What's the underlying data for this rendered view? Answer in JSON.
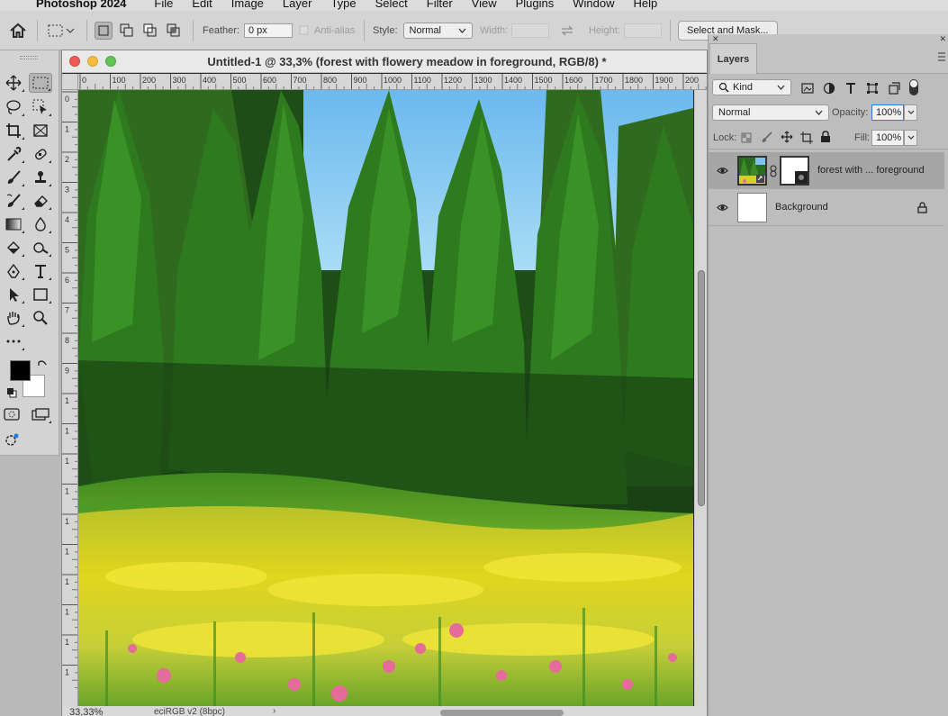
{
  "menubar": {
    "app_name": "Photoshop 2024",
    "items": [
      "File",
      "Edit",
      "Image",
      "Layer",
      "Type",
      "Select",
      "Filter",
      "View",
      "Plugins",
      "Window",
      "Help"
    ]
  },
  "options": {
    "feather_label": "Feather:",
    "feather_value": "0 px",
    "antialias_label": "Anti-alias",
    "style_label": "Style:",
    "style_value": "Normal",
    "width_label": "Width:",
    "height_label": "Height:",
    "select_mask_label": "Select and Mask..."
  },
  "document": {
    "title": "Untitled-1 @ 33,3% (forest with flowery meadow in foreground, RGB/8) *",
    "zoom": "33,33%",
    "profile": "eciRGB v2 (8bpc)",
    "h_ruler": [
      "0",
      "100",
      "200",
      "300",
      "400",
      "500",
      "600",
      "700",
      "800",
      "900",
      "1000",
      "1100",
      "1200",
      "1300",
      "1400",
      "1500",
      "1600",
      "1700",
      "1800",
      "1900",
      "200"
    ],
    "v_ruler": [
      "0",
      "1",
      "2",
      "3",
      "4",
      "5",
      "6",
      "7",
      "8",
      "9",
      "1",
      "1",
      "1",
      "1",
      "1",
      "1",
      "1",
      "1",
      "1",
      "1"
    ]
  },
  "layers_panel": {
    "tab": "Layers",
    "filter_kind": "Kind",
    "blend_mode": "Normal",
    "opacity_label": "Opacity:",
    "opacity_value": "100%",
    "lock_label": "Lock:",
    "fill_label": "Fill:",
    "fill_value": "100%",
    "layers": [
      {
        "name": "forest with ... foreground",
        "selected": true,
        "visible": true
      },
      {
        "name": "Background",
        "selected": false,
        "visible": true,
        "locked": true
      }
    ]
  },
  "colors": {
    "foreground": "#000000",
    "background": "#ffffff"
  }
}
